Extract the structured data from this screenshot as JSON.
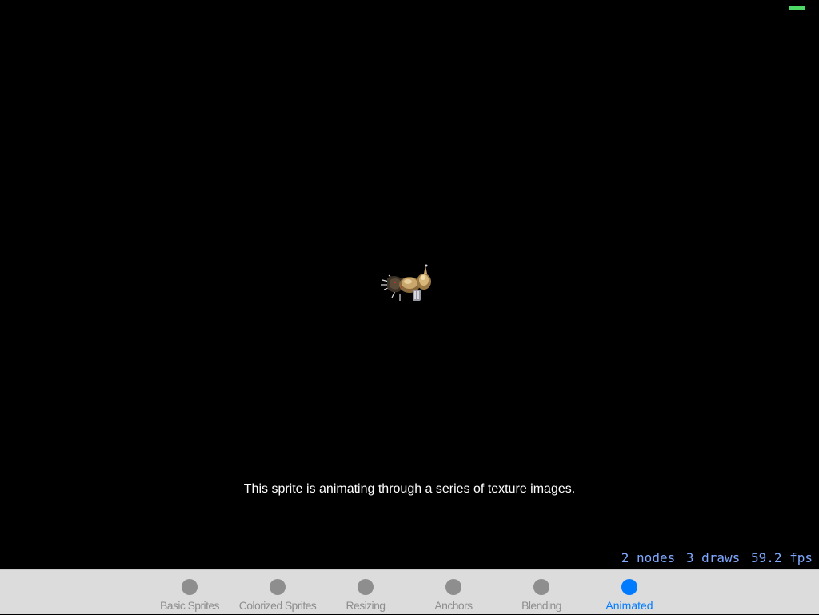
{
  "status_bar": {
    "battery_icon": "battery-icon",
    "battery_color": "#4cd964"
  },
  "scene": {
    "background": "#000000",
    "sprite_icon": "animated-robot-sprite",
    "caption": "This sprite is animating through a series of texture images."
  },
  "stats": {
    "nodes": "2 nodes",
    "draws": "3 draws",
    "fps": "59.2 fps"
  },
  "tab_bar": {
    "selected_color": "#007aff",
    "unselected_color": "#8e8e8e",
    "tabs": [
      {
        "label": "Basic Sprites",
        "selected": false
      },
      {
        "label": "Colorized Sprites",
        "selected": false
      },
      {
        "label": "Resizing",
        "selected": false
      },
      {
        "label": "Anchors",
        "selected": false
      },
      {
        "label": "Blending",
        "selected": false
      },
      {
        "label": "Animated",
        "selected": true
      }
    ]
  }
}
